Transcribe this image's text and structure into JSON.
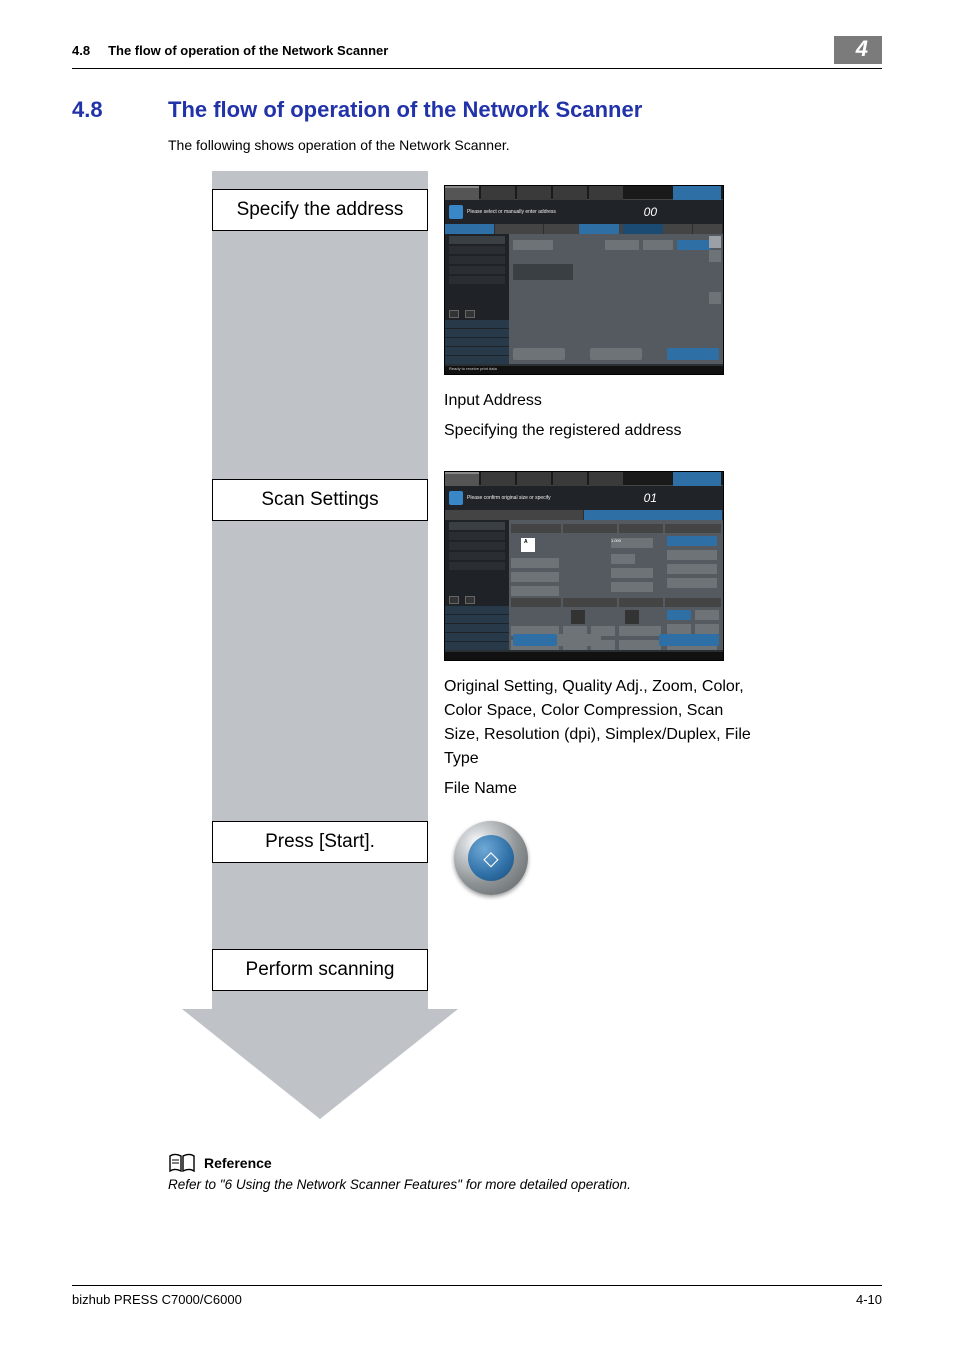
{
  "header": {
    "section_number": "4.8",
    "section_title": "The flow of operation of the Network Scanner",
    "chapter_badge": "4"
  },
  "heading": {
    "number": "4.8",
    "title": "The flow of operation of the Network Scanner"
  },
  "intro": "The following shows operation of the Network Scanner.",
  "flow": {
    "steps": [
      {
        "label": "Specify the address"
      },
      {
        "label": "Scan Settings"
      },
      {
        "label": "Press [Start]."
      },
      {
        "label": "Perform scanning"
      }
    ]
  },
  "screens": {
    "address": {
      "prompt": "Please select or manually enter address",
      "counter": "00",
      "status": "Ready to receive print data",
      "captions": [
        "Input Address",
        "Specifying the registered address"
      ]
    },
    "scan_settings": {
      "prompt": "Please confirm original size or specify",
      "counter": "01",
      "value_1000": "1.000",
      "captions": [
        "Original Setting, Quality Adj., Zoom, Color, Color Space, Color Compression, Scan Size, Resolution (dpi), Simplex/Duplex, File Type",
        "File Name"
      ]
    }
  },
  "reference": {
    "label": "Reference",
    "text": "Refer to \"6 Using the Network Scanner Features\" for more detailed operation."
  },
  "footer": {
    "product": "bizhub PRESS C7000/C6000",
    "page": "4-10"
  }
}
